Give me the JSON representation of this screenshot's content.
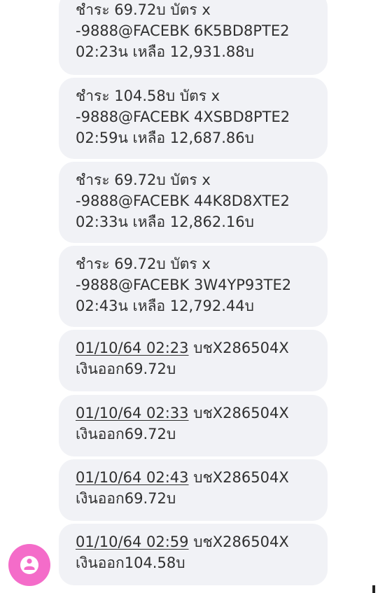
{
  "card_messages": [
    {
      "line1": "ชำระ 69.72บ บัตร x",
      "line2": "-9888@FACEBK 6K5BD8PTE2",
      "line3": "02:23น เหลือ 12,931.88บ"
    },
    {
      "line1": "ชำระ 104.58บ บัตร x",
      "line2": "-9888@FACEBK 4XSBD8PTE2",
      "line3": "02:59น เหลือ 12,687.86บ"
    },
    {
      "line1": "ชำระ 69.72บ บัตร x",
      "line2": "-9888@FACEBK 44K8D8XTE2",
      "line3": "02:33น เหลือ 12,862.16บ"
    },
    {
      "line1": "ชำระ 69.72บ บัตร x",
      "line2": "-9888@FACEBK 3W4YP93TE2",
      "line3": "02:43น เหลือ 12,792.44บ"
    }
  ],
  "withdrawal_messages": [
    {
      "datetime": "01/10/64 02:23",
      "account": " บชX286504X",
      "line2": "เงินออก69.72บ"
    },
    {
      "datetime": "01/10/64 02:33",
      "account": " บชX286504X",
      "line2": "เงินออก69.72บ"
    },
    {
      "datetime": "01/10/64 02:43",
      "account": " บชX286504X",
      "line2": "เงินออก69.72บ"
    },
    {
      "datetime": "01/10/64 02:59",
      "account": " บชX286504X",
      "line2": "เงินออก104.58บ"
    }
  ],
  "avatar": {
    "icon": "person-icon",
    "color": "#f46cc9"
  },
  "colors": {
    "bubble": "#f1f2f6",
    "text": "#303030"
  }
}
